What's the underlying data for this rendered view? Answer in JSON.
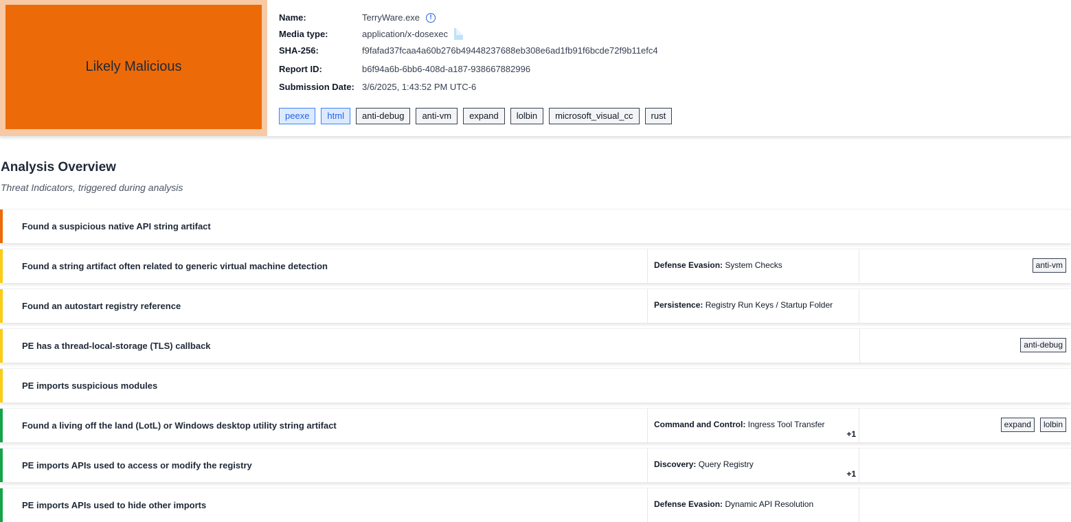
{
  "verdict": {
    "label": "Likely Malicious",
    "color": "#ec6a08"
  },
  "file": {
    "labels": {
      "name": "Name:",
      "media_type": "Media type:",
      "sha256": "SHA-256:",
      "report_id": "Report ID:",
      "submission_date": "Submission Date:"
    },
    "name": "TerryWare.exe",
    "info_icon": "!",
    "media_type": "application/x-dosexec",
    "sha256": "f9fafad37fcaa4a60b276b49448237688eb308e6ad1fb91f6bcde72f9b11efc4",
    "report_id": "b6f94a6b-6bb6-408d-a187-938667882996",
    "submission_date": "3/6/2025, 1:43:52 PM UTC-6"
  },
  "tags": [
    "peexe",
    "html",
    "anti-debug",
    "anti-vm",
    "expand",
    "lolbin",
    "microsoft_visual_cc",
    "rust"
  ],
  "overview": {
    "title": "Analysis Overview",
    "subtitle": "Threat Indicators, triggered during analysis"
  },
  "indicators": [
    {
      "title": "Found a suspicious native API string artifact",
      "severity_color": "#ec6a08",
      "tactic": "",
      "technique": "",
      "more": "",
      "tags": [],
      "full": true
    },
    {
      "title": "Found a string artifact often related to generic virtual machine detection",
      "severity_color": "#facc15",
      "tactic": "Defense Evasion:",
      "technique": "System Checks",
      "more": "",
      "tags": [
        "anti-vm"
      ],
      "full": false
    },
    {
      "title": "Found an autostart registry reference",
      "severity_color": "#facc15",
      "tactic": "Persistence:",
      "technique": "Registry Run Keys / Startup Folder",
      "more": "",
      "tags": [],
      "full": false
    },
    {
      "title": "PE has a thread-local-storage (TLS) callback",
      "severity_color": "#facc15",
      "tactic": "",
      "technique": "",
      "more": "",
      "tags": [
        "anti-debug"
      ],
      "full": false,
      "no_tactic": true
    },
    {
      "title": "PE imports suspicious modules",
      "severity_color": "#facc15",
      "tactic": "",
      "technique": "",
      "more": "",
      "tags": [],
      "full": true
    },
    {
      "title": "Found a living off the land (LotL) or Windows desktop utility string artifact",
      "severity_color": "#16a34a",
      "tactic": "Command and Control:",
      "technique": "Ingress Tool Transfer",
      "more": "+1",
      "tags": [
        "expand",
        "lolbin"
      ],
      "full": false
    },
    {
      "title": "PE imports APIs used to access or modify the registry",
      "severity_color": "#16a34a",
      "tactic": "Discovery:",
      "technique": "Query Registry",
      "more": "+1",
      "tags": [],
      "full": false
    },
    {
      "title": "PE imports APIs used to hide other imports",
      "severity_color": "#16a34a",
      "tactic": "Defense Evasion:",
      "technique": "Dynamic API Resolution",
      "more": "",
      "tags": [],
      "full": false
    }
  ]
}
